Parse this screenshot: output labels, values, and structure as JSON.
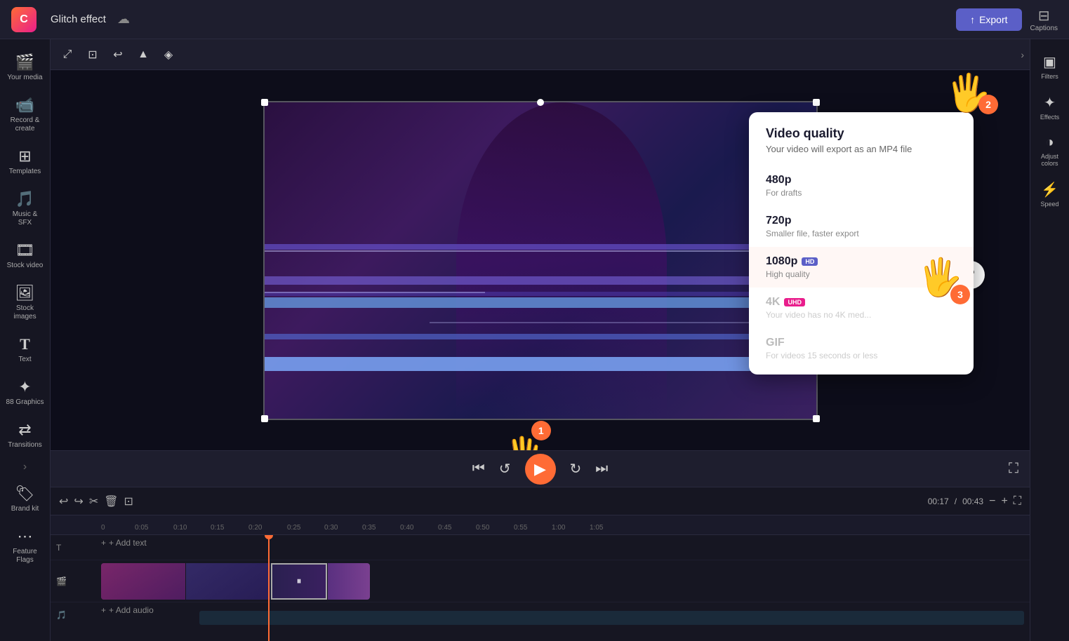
{
  "app": {
    "logo_text": "C",
    "project_title": "Glitch effect",
    "export_label": "Export",
    "captions_label": "Captions"
  },
  "left_sidebar": {
    "items": [
      {
        "id": "your-media",
        "icon": "🎬",
        "label": "Your media"
      },
      {
        "id": "record-create",
        "icon": "📹",
        "label": "Record &\ncreate"
      },
      {
        "id": "templates",
        "icon": "⊞",
        "label": "Templates"
      },
      {
        "id": "music-sfx",
        "icon": "🎵",
        "label": "Music & SFX"
      },
      {
        "id": "stock-video",
        "icon": "🎞",
        "label": "Stock video"
      },
      {
        "id": "stock-images",
        "icon": "🖼",
        "label": "Stock images"
      },
      {
        "id": "text",
        "icon": "T",
        "label": "Text"
      },
      {
        "id": "graphics",
        "icon": "✦",
        "label": "88 Graphics"
      },
      {
        "id": "transitions",
        "icon": "⇄",
        "label": "Transitions"
      },
      {
        "id": "brand-kit",
        "icon": "🏷",
        "label": "Brand kit"
      },
      {
        "id": "feature-flags",
        "icon": "⋯",
        "label": "Feature Flags"
      }
    ]
  },
  "right_sidebar": {
    "items": [
      {
        "id": "filters",
        "icon": "▣",
        "label": "Filters"
      },
      {
        "id": "effects",
        "icon": "✦",
        "label": "Effects"
      },
      {
        "id": "adjust-colors",
        "icon": "◑",
        "label": "Adjust colors"
      },
      {
        "id": "speed",
        "icon": "⚡",
        "label": "Speed"
      }
    ]
  },
  "video_tools": {
    "tools": [
      "⤢",
      "✂",
      "↩",
      "▲"
    ]
  },
  "playback": {
    "time_current": "00:17",
    "time_total": "00:43",
    "rewind_label": "⏮",
    "back5_label": "↺",
    "play_label": "▶",
    "forward5_label": "↻",
    "skip_label": "⏭",
    "fullscreen_label": "⛶"
  },
  "timeline": {
    "undo_label": "↩",
    "redo_label": "↪",
    "cut_label": "✂",
    "delete_label": "🗑",
    "duplicate_label": "⊡",
    "time_display": "00:17",
    "time_separator": "",
    "time_end": "00:43",
    "zoom_out": "−",
    "zoom_in": "+",
    "expand_label": "⛶",
    "add_text_label": "+ Add text",
    "add_audio_label": "+ Add audio",
    "ruler_marks": [
      "0",
      "0:05",
      "0:10",
      "0:15",
      "0:20",
      "0:25",
      "0:30",
      "0:35",
      "0:40",
      "0:45",
      "0:50",
      "0:55",
      "1:00",
      "1:05"
    ],
    "ruler_positions": [
      72,
      120,
      168,
      216,
      264,
      312,
      360,
      408,
      456,
      504,
      552,
      600,
      648,
      696
    ]
  },
  "quality_popup": {
    "title": "Video quality",
    "subtitle": "Your video will export as an MP4 file",
    "options": [
      {
        "id": "480p",
        "name": "480p",
        "badge": null,
        "badge_type": null,
        "desc": "For drafts",
        "disabled": false
      },
      {
        "id": "720p",
        "name": "720p",
        "badge": null,
        "badge_type": null,
        "desc": "Smaller file, faster export",
        "disabled": false
      },
      {
        "id": "1080p",
        "name": "1080p",
        "badge": "HD",
        "badge_type": "hd",
        "desc": "High quality",
        "disabled": false
      },
      {
        "id": "4k",
        "name": "4K",
        "badge": "UHD",
        "badge_type": "uhd",
        "desc": "Your video has no 4K med...",
        "disabled": true
      },
      {
        "id": "gif",
        "name": "GIF",
        "badge": null,
        "badge_type": null,
        "desc": "For videos 15 seconds or less",
        "disabled": true
      }
    ]
  },
  "cursor_annotations": [
    {
      "id": "cursor1",
      "step": "1"
    },
    {
      "id": "cursor2",
      "step": "2"
    },
    {
      "id": "cursor3",
      "step": "3"
    }
  ],
  "help": {
    "label": "?"
  }
}
